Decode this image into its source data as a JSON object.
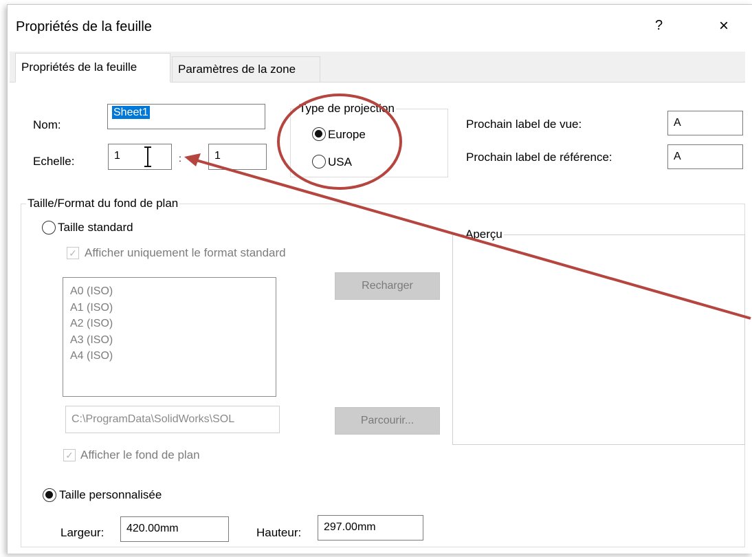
{
  "window": {
    "title": "Propriétés de la feuille",
    "help": "?",
    "close": "×"
  },
  "tabs": [
    {
      "label": "Propriétés de la feuille"
    },
    {
      "label": "Paramètres de la zone"
    }
  ],
  "name": {
    "label": "Nom:",
    "value": "Sheet1"
  },
  "scale": {
    "label": "Echelle:",
    "numerator": "1",
    "denominator": "1"
  },
  "projection": {
    "title": "Type de projection",
    "options": [
      {
        "label": "Europe",
        "selected": true
      },
      {
        "label": "USA",
        "selected": false
      }
    ]
  },
  "next_view_label": {
    "label": "Prochain label de vue:",
    "value": "A"
  },
  "next_ref_label": {
    "label": "Prochain label de référence:",
    "value": "A"
  },
  "sheet_format": {
    "group_title": "Taille/Format du fond de plan",
    "standard_size": {
      "label": "Taille standard",
      "selected": false
    },
    "show_standard_only": {
      "label": "Afficher uniquement le format standard",
      "checked": true
    },
    "formats": [
      "A0 (ISO)",
      "A1 (ISO)",
      "A2 (ISO)",
      "A3 (ISO)",
      "A4 (ISO)"
    ],
    "reload_button": "Recharger",
    "path": "C:\\ProgramData\\SolidWorks\\SOL",
    "browse_button": "Parcourir...",
    "show_format": {
      "label": "Afficher le fond de plan",
      "checked": true
    },
    "custom_size": {
      "label": "Taille personnalisée",
      "selected": true
    },
    "width": {
      "label": "Largeur:",
      "value": "420.00mm"
    },
    "height": {
      "label": "Hauteur:",
      "value": "297.00mm"
    }
  },
  "preview": {
    "label": "Aperçu"
  },
  "annotation": {
    "color": "#b5453f"
  }
}
